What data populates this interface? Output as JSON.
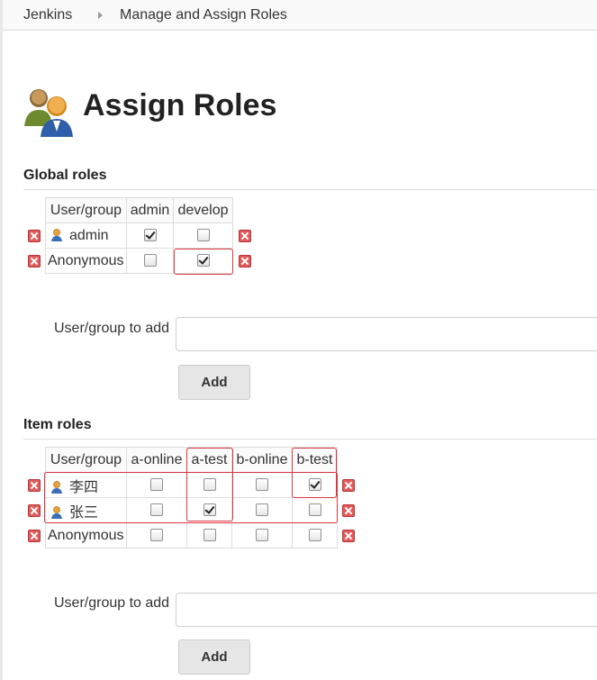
{
  "breadcrumb": {
    "home": "Jenkins",
    "current": "Manage and Assign Roles"
  },
  "page": {
    "title": "Assign Roles"
  },
  "global_roles": {
    "heading": "Global roles",
    "columns": [
      "User/group",
      "admin",
      "develop"
    ],
    "rows": [
      {
        "name": "admin",
        "type": "user",
        "checks": [
          true,
          false
        ]
      },
      {
        "name": "Anonymous",
        "type": "anonymous",
        "checks": [
          false,
          true
        ]
      }
    ],
    "add_label": "User/group to add",
    "add_input_value": "",
    "add_button": "Add"
  },
  "item_roles": {
    "heading": "Item roles",
    "columns": [
      "User/group",
      "a-online",
      "a-test",
      "b-online",
      "b-test"
    ],
    "rows": [
      {
        "name": "李四",
        "type": "user",
        "checks": [
          false,
          false,
          false,
          true
        ]
      },
      {
        "name": "张三",
        "type": "user",
        "checks": [
          false,
          true,
          false,
          false
        ]
      },
      {
        "name": "Anonymous",
        "type": "anonymous",
        "checks": [
          false,
          false,
          false,
          false
        ]
      }
    ],
    "add_label": "User/group to add",
    "add_input_value": "",
    "add_button": "Add"
  },
  "icons": {
    "delete": "delete-icon",
    "user": "user-icon",
    "title": "users-group-icon",
    "breadcrumb_separator": "chevron-right-icon"
  },
  "colors": {
    "highlight": "#d9363e",
    "delete": "#e05c5c"
  }
}
